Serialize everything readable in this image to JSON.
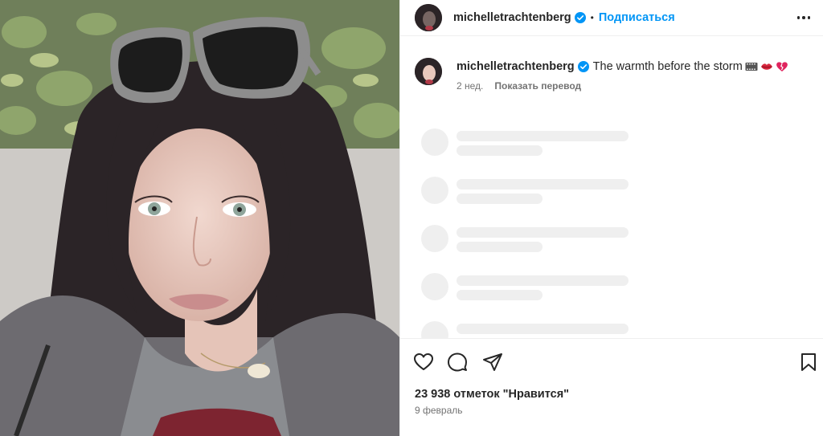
{
  "post": {
    "username": "michelletrachtenberg",
    "follow_label": "Подписаться",
    "dot": "•",
    "caption_text": "The warmth before the storm",
    "caption_emojis": [
      "film-frames-icon",
      "kiss-mark-icon",
      "broken-heart-icon"
    ],
    "time_ago": "2 нед.",
    "translate_label": "Показать перевод",
    "likes_text": "23 938 отметок \"Нравится\"",
    "date_text": "9 февраль"
  },
  "icons": {
    "verified": "verified-badge-icon",
    "more": "more-options-icon",
    "like": "heart-icon",
    "comment": "comment-icon",
    "share": "share-icon",
    "save": "bookmark-icon"
  },
  "colors": {
    "accent": "#0095f6",
    "text": "#262626",
    "muted": "#737373",
    "skeleton": "#efefef",
    "divider": "#efefef"
  }
}
